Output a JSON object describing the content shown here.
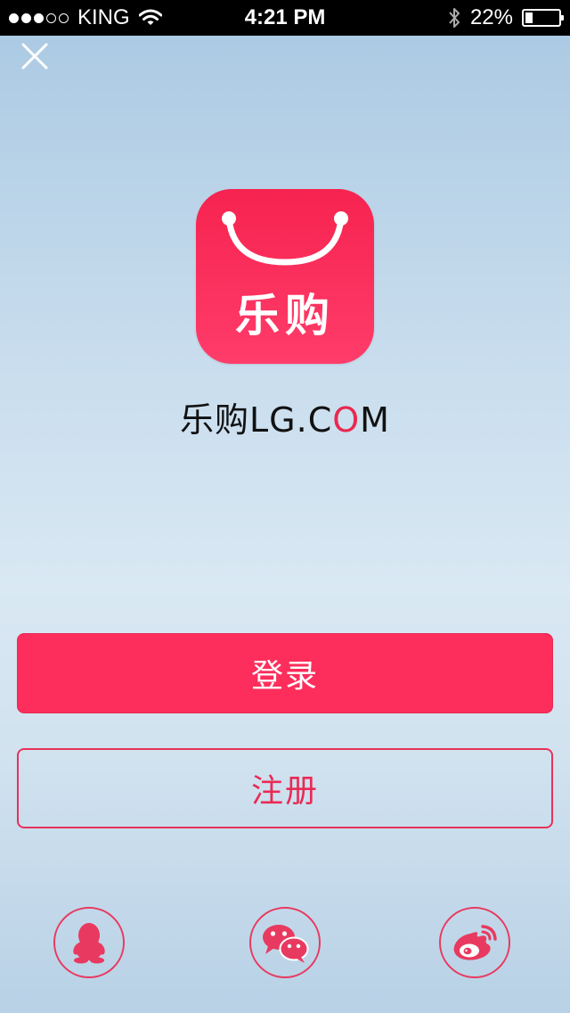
{
  "status_bar": {
    "carrier": "KING",
    "time": "4:21 PM",
    "battery": "22%",
    "battery_level": 0.22
  },
  "logo": {
    "text": "乐购"
  },
  "brand": {
    "prefix": "乐购LG.C",
    "heart_letter": "O",
    "suffix": "M"
  },
  "buttons": {
    "login_label": "登录",
    "register_label": "注册"
  },
  "colors": {
    "accent": "#fd2e5c",
    "outline": "#e8315a"
  },
  "social": {
    "icons": [
      "qq-icon",
      "wechat-icon",
      "weibo-icon"
    ]
  }
}
